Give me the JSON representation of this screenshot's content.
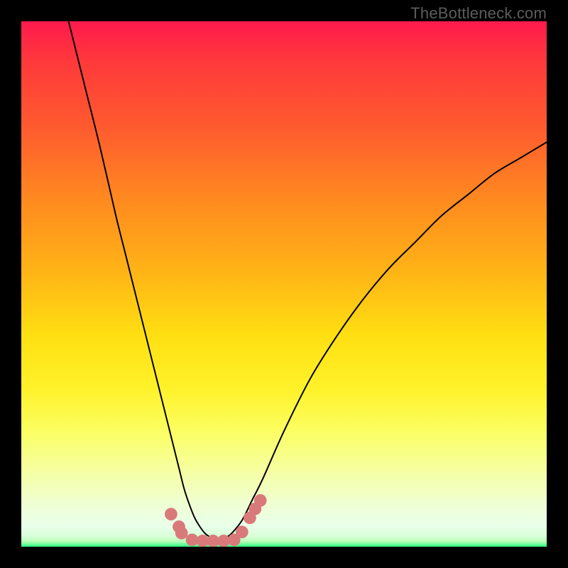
{
  "watermark": "TheBottleneck.com",
  "chart_data": {
    "type": "line",
    "title": "",
    "xlabel": "",
    "ylabel": "",
    "xlim": [
      0,
      100
    ],
    "ylim": [
      0,
      100
    ],
    "grid": false,
    "series": [
      {
        "name": "curve",
        "color": "#000000",
        "x": [
          9,
          12,
          15,
          18,
          20,
          22,
          24,
          26,
          28,
          29,
          30,
          31,
          32,
          33,
          34,
          35,
          36,
          37,
          38,
          39,
          40,
          42,
          44,
          46,
          50,
          55,
          60,
          65,
          70,
          75,
          80,
          85,
          90,
          95,
          100
        ],
        "y": [
          100,
          88,
          76,
          63,
          55,
          47,
          39,
          31,
          23,
          19,
          15,
          11,
          8,
          5.5,
          3.8,
          2.5,
          1.8,
          1.3,
          1.3,
          1.8,
          2.5,
          5,
          9,
          13,
          22,
          32,
          40,
          47,
          53,
          58,
          63,
          67,
          71,
          74,
          77
        ]
      }
    ],
    "markers": [
      {
        "x": 28.5,
        "y": 6.2,
        "r": 1.2,
        "color": "#d97a7a"
      },
      {
        "x": 30.0,
        "y": 3.8,
        "r": 1.2,
        "color": "#d97a7a"
      },
      {
        "x": 30.5,
        "y": 2.6,
        "r": 1.2,
        "color": "#d97a7a"
      },
      {
        "x": 32.5,
        "y": 1.3,
        "r": 1.2,
        "color": "#d97a7a"
      },
      {
        "x": 34.5,
        "y": 1.1,
        "r": 1.2,
        "color": "#d97a7a"
      },
      {
        "x": 36.5,
        "y": 1.1,
        "r": 1.2,
        "color": "#d97a7a"
      },
      {
        "x": 38.5,
        "y": 1.1,
        "r": 1.2,
        "color": "#d97a7a"
      },
      {
        "x": 40.5,
        "y": 1.3,
        "r": 1.2,
        "color": "#d97a7a"
      },
      {
        "x": 42.0,
        "y": 2.8,
        "r": 1.2,
        "color": "#d97a7a"
      },
      {
        "x": 43.5,
        "y": 5.5,
        "r": 1.2,
        "color": "#d97a7a"
      },
      {
        "x": 44.5,
        "y": 7.2,
        "r": 1.2,
        "color": "#d97a7a"
      },
      {
        "x": 45.5,
        "y": 8.8,
        "r": 1.2,
        "color": "#d97a7a"
      }
    ]
  }
}
